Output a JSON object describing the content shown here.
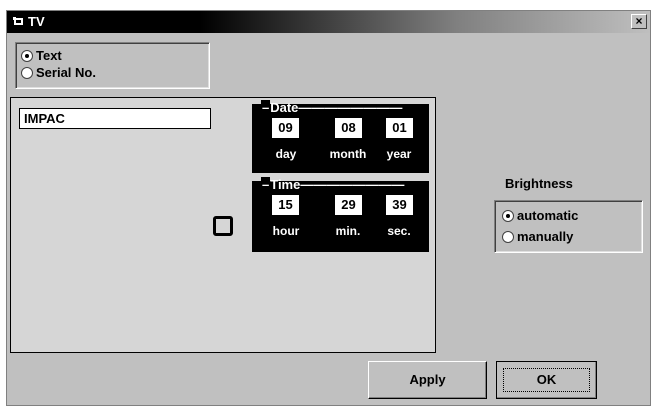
{
  "window": {
    "title": "TV",
    "title_icon": "tv-icon",
    "close_label": "×"
  },
  "mode": {
    "options": [
      {
        "label": "Text",
        "selected": true
      },
      {
        "label": "Serial No.",
        "selected": false
      }
    ]
  },
  "text_field": {
    "value": "IMPAC"
  },
  "date": {
    "label": "Date",
    "day": "09",
    "month": "08",
    "year": "01",
    "units": {
      "day": "day",
      "month": "month",
      "year": "year"
    }
  },
  "time": {
    "label": "Time",
    "hour": "15",
    "min": "29",
    "sec": "39",
    "units": {
      "hour": "hour",
      "min": "min.",
      "sec": "sec."
    }
  },
  "brightness": {
    "label": "Brightness",
    "options": [
      {
        "label": "automatic",
        "selected": true
      },
      {
        "label": "manually",
        "selected": false
      }
    ]
  },
  "buttons": {
    "apply": "Apply",
    "ok": "OK"
  }
}
